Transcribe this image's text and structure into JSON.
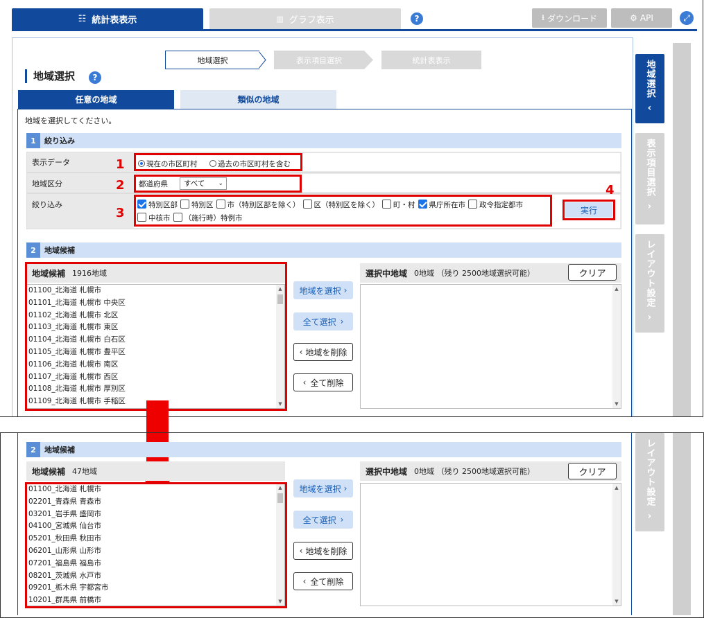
{
  "header": {
    "tab_stats": "統計表表示",
    "tab_graph": "グラフ表示",
    "help": "?",
    "download": "ダウンロード",
    "api": "API"
  },
  "steps": [
    "地域選択",
    "表示項目選択",
    "統計表表示"
  ],
  "page_title": "地域選択",
  "subtabs": [
    "任意の地域",
    "類似の地域"
  ],
  "instruction": "地域を選択してください。",
  "filter": {
    "bar_num": "1",
    "bar_label": "絞り込み",
    "row1_label": "表示データ",
    "radio1": "現在の市区町村",
    "radio2": "過去の市区町村を含む",
    "row2_label": "地域区分",
    "region_type": "都道府県",
    "region_select": "すべて",
    "row3_label": "絞り込み",
    "checks": [
      {
        "label": "特別区部",
        "checked": true
      },
      {
        "label": "特別区",
        "checked": false
      },
      {
        "label": "市（特別区部を除く）",
        "checked": false
      },
      {
        "label": "区（特別区を除く）",
        "checked": false
      },
      {
        "label": "町・村",
        "checked": false
      },
      {
        "label": "県庁所在市",
        "checked": true
      },
      {
        "label": "政令指定都市",
        "checked": false
      },
      {
        "label": "中核市",
        "checked": false
      },
      {
        "label": "（施行時）特例市",
        "checked": false
      }
    ],
    "exec": "実行"
  },
  "annotations": [
    "1",
    "2",
    "3",
    "4"
  ],
  "candidates": {
    "bar_num": "2",
    "bar_label": "地域候補",
    "header": "地域候補",
    "count_before": "1916地域",
    "count_after": "47地域",
    "items_before": [
      "01100_北海道 札幌市",
      "01101_北海道 札幌市 中央区",
      "01102_北海道 札幌市 北区",
      "01103_北海道 札幌市 東区",
      "01104_北海道 札幌市 白石区",
      "01105_北海道 札幌市 豊平区",
      "01106_北海道 札幌市 南区",
      "01107_北海道 札幌市 西区",
      "01108_北海道 札幌市 厚別区",
      "01109_北海道 札幌市 手稲区"
    ],
    "items_after": [
      "01100_北海道 札幌市",
      "02201_青森県 青森市",
      "03201_岩手県 盛岡市",
      "04100_宮城県 仙台市",
      "05201_秋田県 秋田市",
      "06201_山形県 山形市",
      "07201_福島県 福島市",
      "08201_茨城県 水戸市",
      "09201_栃木県 宇都宮市",
      "10201_群馬県 前橋市"
    ]
  },
  "selected": {
    "header": "選択中地域",
    "count": "0地域 （残り 2500地域選択可能）",
    "clear": "クリア"
  },
  "buttons": {
    "select_region": "地域を選択",
    "select_all": "全て選択",
    "delete_region": "地域を削除",
    "delete_all": "全て削除"
  },
  "side": {
    "tab1": "地域選択",
    "tab2": "表示項目選択",
    "tab3": "レイアウト設定"
  },
  "colors": {
    "primary": "#114a9c",
    "accent_red": "#e00000",
    "light_blue": "#cfe0f7"
  }
}
